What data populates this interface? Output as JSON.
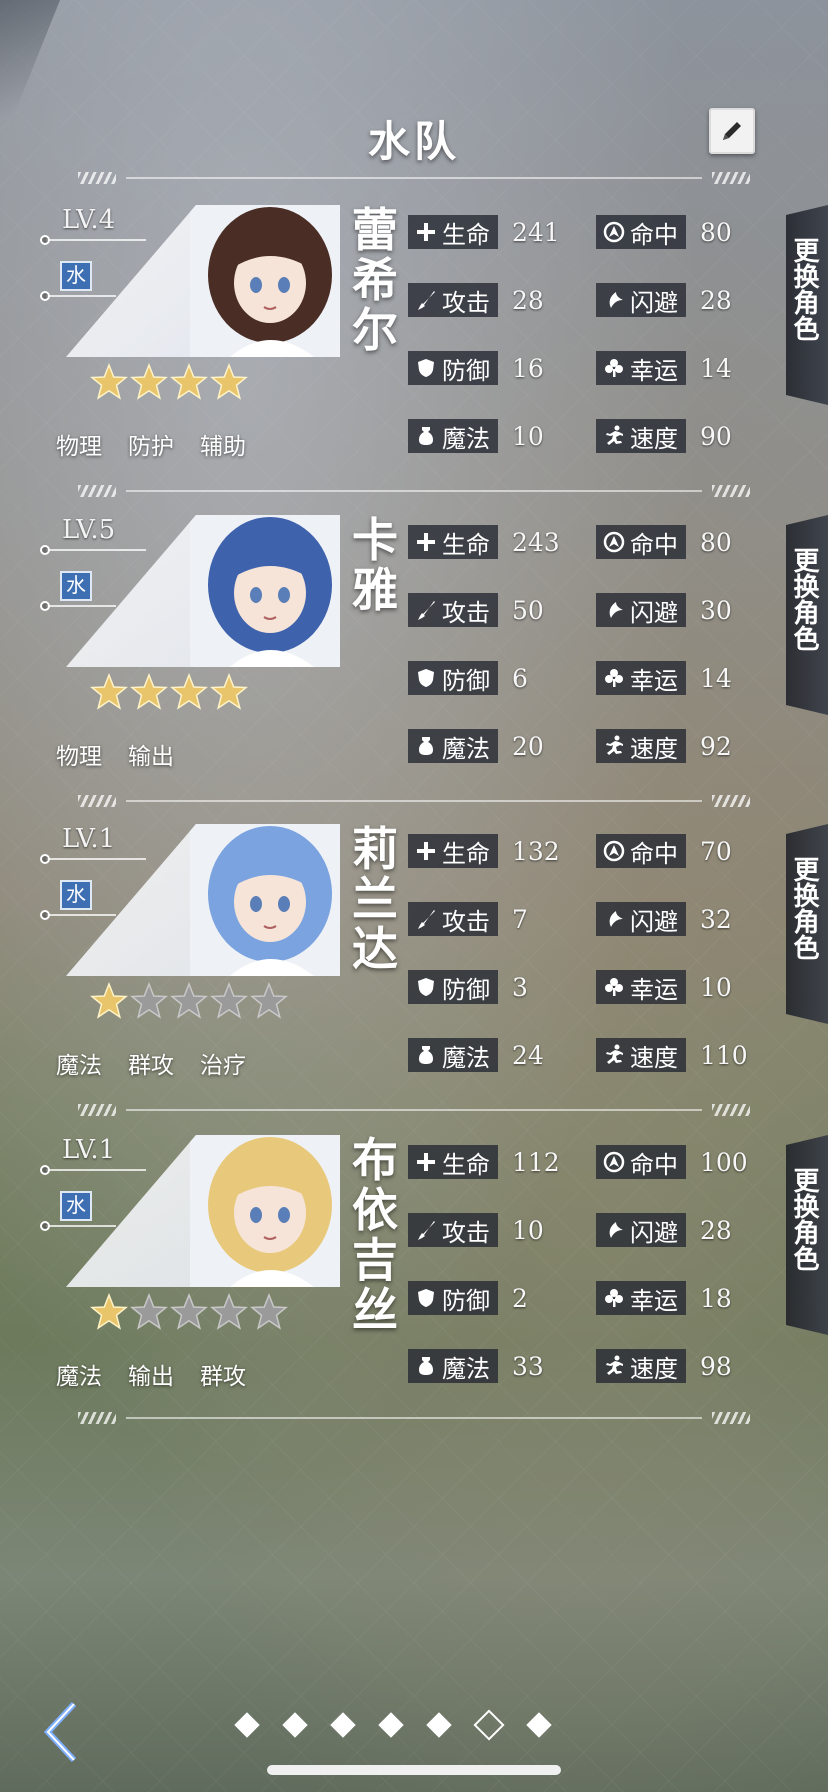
{
  "header": {
    "title": "水队"
  },
  "swap_label": "更换角色",
  "stat_labels": {
    "hp": "生命",
    "hit": "命中",
    "atk": "攻击",
    "eva": "闪避",
    "def": "防御",
    "luck": "幸运",
    "mag": "魔法",
    "spd": "速度"
  },
  "characters": [
    {
      "level": "LV.4",
      "element": "水",
      "name": "蕾希尔",
      "stars": 4,
      "tags": [
        "物理",
        "防护",
        "辅助"
      ],
      "stats": {
        "hp": "241",
        "hit": "80",
        "atk": "28",
        "eva": "28",
        "def": "16",
        "luck": "14",
        "mag": "10",
        "spd": "90"
      },
      "hair_color": "#4a2e26"
    },
    {
      "level": "LV.5",
      "element": "水",
      "name": "卡雅",
      "stars": 4,
      "tags": [
        "物理",
        "输出"
      ],
      "stats": {
        "hp": "243",
        "hit": "80",
        "atk": "50",
        "eva": "30",
        "def": "6",
        "luck": "14",
        "mag": "20",
        "spd": "92"
      },
      "hair_color": "#3f62ad"
    },
    {
      "level": "LV.1",
      "element": "水",
      "name": "莉兰达",
      "stars": 1,
      "tags": [
        "魔法",
        "群攻",
        "治疗"
      ],
      "stats": {
        "hp": "132",
        "hit": "70",
        "atk": "7",
        "eva": "32",
        "def": "3",
        "luck": "10",
        "mag": "24",
        "spd": "110"
      },
      "hair_color": "#7aa3e0"
    },
    {
      "level": "LV.1",
      "element": "水",
      "name": "布依吉丝",
      "stars": 1,
      "tags": [
        "魔法",
        "输出",
        "群攻"
      ],
      "stats": {
        "hp": "112",
        "hit": "100",
        "atk": "10",
        "eva": "28",
        "def": "2",
        "luck": "18",
        "mag": "33",
        "spd": "98"
      },
      "hair_color": "#e8c97c"
    }
  ],
  "pager": {
    "count": 7,
    "active_index": 5
  },
  "icons": {
    "edit": "pencil-icon",
    "back": "chevron-left-icon",
    "hp": "plus-icon",
    "hit": "crosshair-icon",
    "atk": "sword-icon",
    "eva": "dodge-icon",
    "def": "shield-icon",
    "luck": "clover-icon",
    "mag": "potion-icon",
    "spd": "runner-icon"
  },
  "colors": {
    "element_water": "#3f6fb3",
    "star_gold": "#e8c46a",
    "star_gray": "#9a9a9a"
  }
}
